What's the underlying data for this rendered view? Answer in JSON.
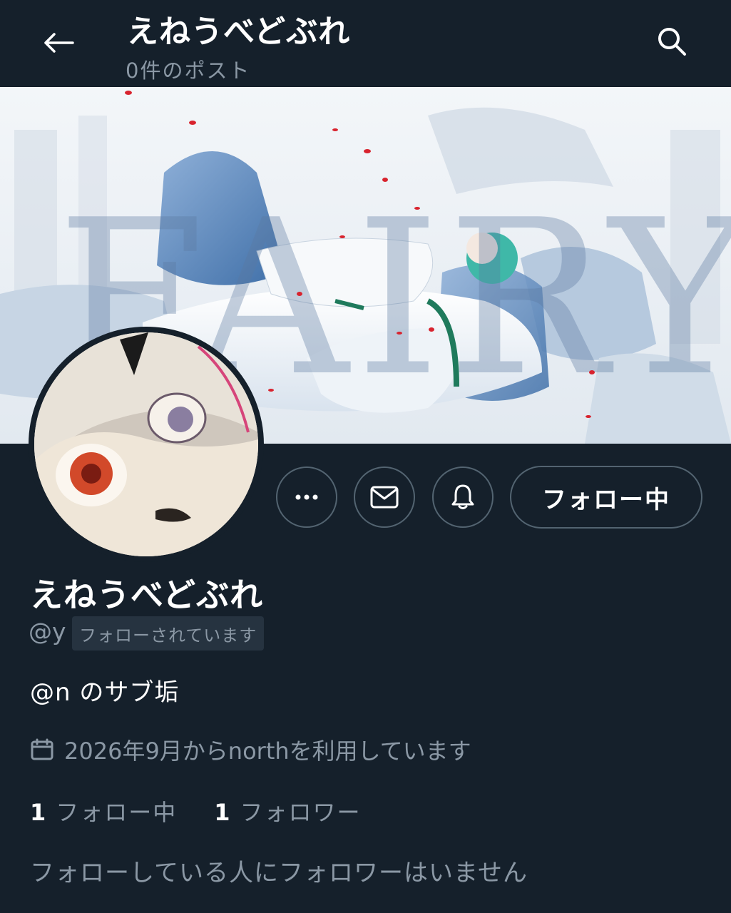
{
  "header": {
    "title": "えねうべどぶれ",
    "post_count": "0件のポスト",
    "back_icon": "arrow-left-icon",
    "search_icon": "search-icon"
  },
  "banner": {
    "overlay_text": "FAIRY"
  },
  "actions": {
    "more_icon": "more-horizontal-icon",
    "message_icon": "mail-icon",
    "notify_icon": "bell-icon",
    "follow_label": "フォロー中"
  },
  "profile": {
    "display_name": "えねうべどぶれ",
    "handle": "@y",
    "follows_you": "フォローされています",
    "bio": "@n のサブ垢",
    "joined": "2026年9月からnorthを利用しています",
    "following_count": "1",
    "following_label": "フォロー中",
    "followers_count": "1",
    "followers_label": "フォロワー",
    "mutual_note": "フォローしている人にフォロワーはいません"
  },
  "colors": {
    "background": "#15202b",
    "secondary_text": "#8b98a5",
    "border": "#536471",
    "badge_bg": "#263340"
  }
}
